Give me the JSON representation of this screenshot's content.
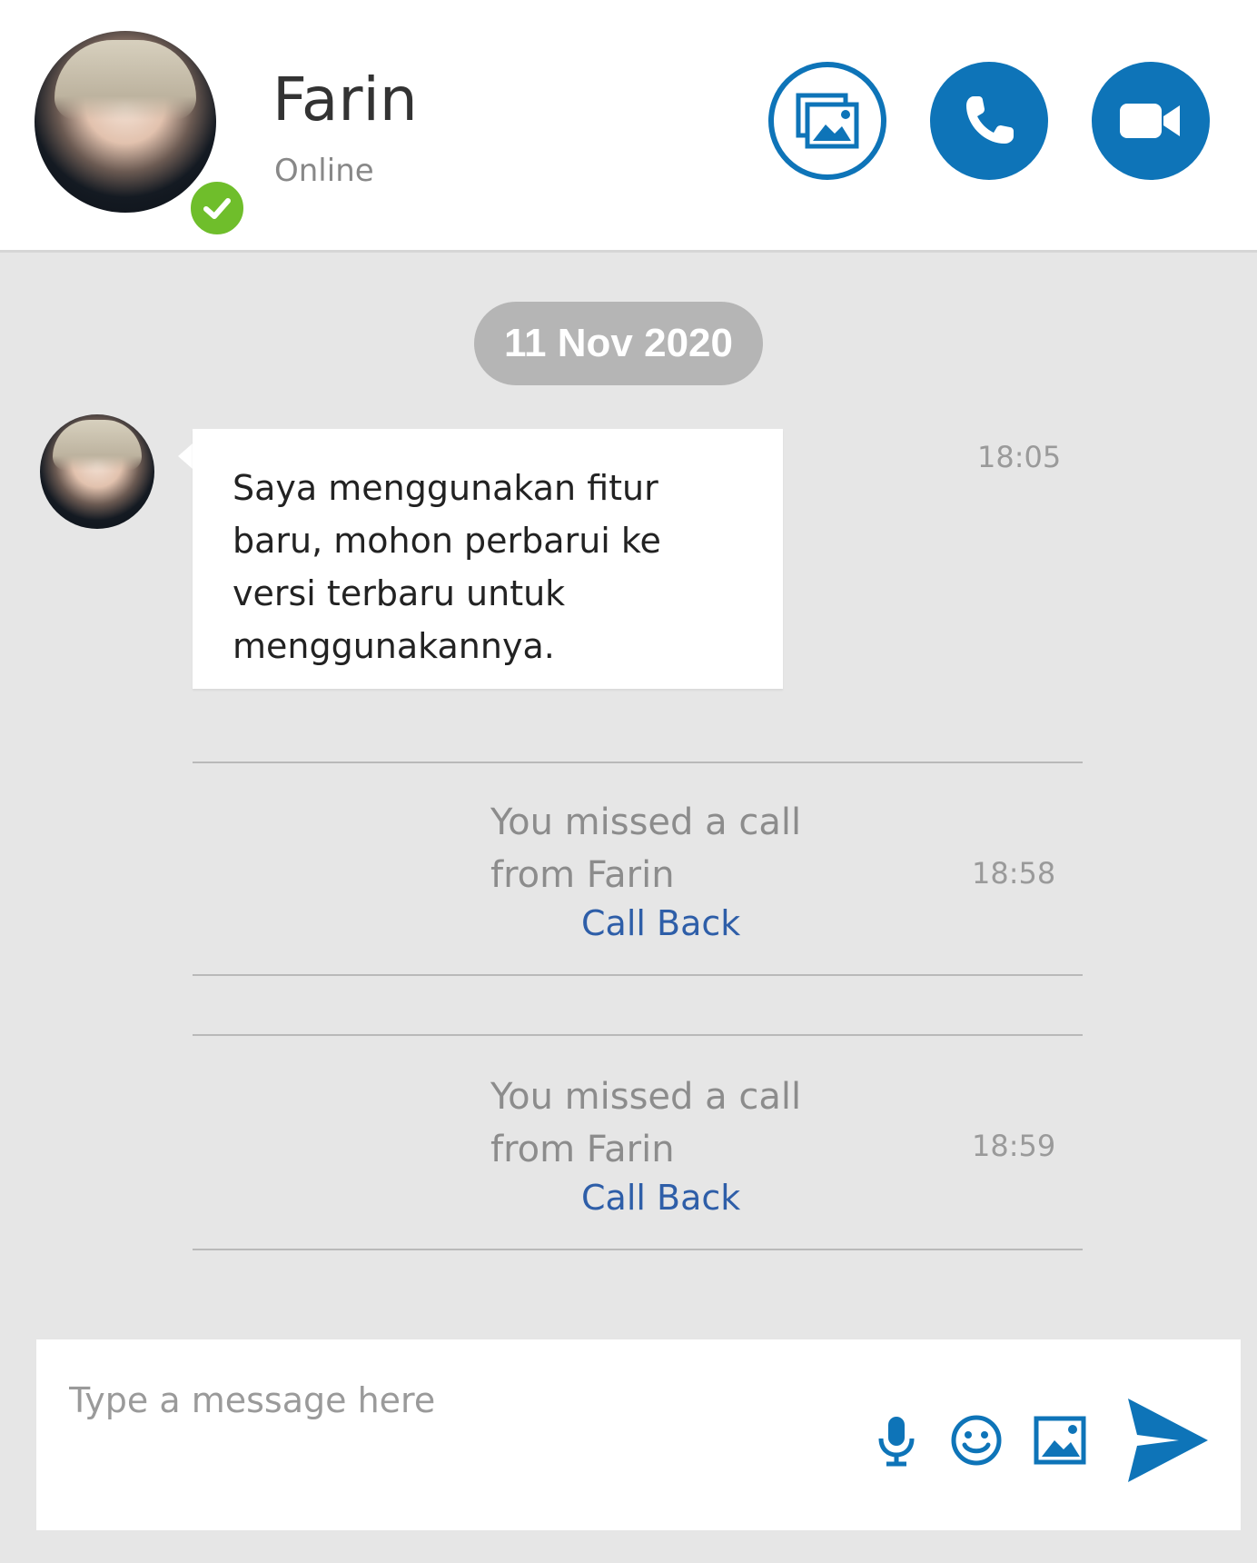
{
  "header": {
    "contact_name": "Farin",
    "status": "Online",
    "buttons": {
      "gallery": "gallery-icon",
      "call": "phone-icon",
      "video": "video-camera-icon"
    }
  },
  "conversation": {
    "date": "11 Nov 2020",
    "message": {
      "text": "Saya menggunakan fitur baru, mohon perbarui ke versi terbaru untuk menggunakannya.",
      "time": "18:05"
    },
    "missed_calls": [
      {
        "line1": "You missed a call",
        "line2": "from Farin",
        "action": "Call Back",
        "time": "18:58"
      },
      {
        "line1": "You missed a call",
        "line2": "from Farin",
        "action": "Call Back",
        "time": "18:59"
      }
    ]
  },
  "composer": {
    "placeholder": "Type a message here",
    "icons": [
      "microphone-icon",
      "emoji-icon",
      "image-icon",
      "send-icon"
    ]
  },
  "colors": {
    "accent": "#0e74b8",
    "presence": "#6fbe2b",
    "date_pill": "#b5b5b5",
    "link": "#2e5ea8"
  }
}
